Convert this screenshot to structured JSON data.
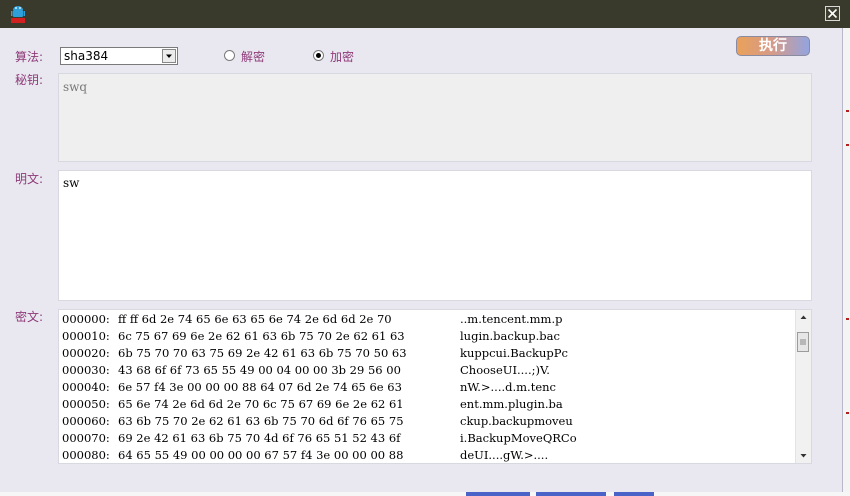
{
  "window": {
    "icon": "android-robot-icon",
    "close": "close-icon"
  },
  "form": {
    "algorithm_label": "算法:",
    "algorithm_value": "sha384",
    "radio_decrypt": "解密",
    "radio_encrypt": "加密",
    "selected_mode": "encrypt",
    "execute_label": "执行",
    "key_label": "秘钥:",
    "key_value": "swq",
    "plaintext_label": "明文:",
    "plaintext_value": "sw",
    "ciphertext_label": "密文:"
  },
  "hexdump": [
    {
      "addr": "000000:",
      "bytes": "ff ff 6d 2e 74 65 6e 63 65 6e 74 2e 6d 6d 2e 70",
      "ascii": "..m.tencent.mm.p"
    },
    {
      "addr": "000010:",
      "bytes": "6c 75 67 69 6e 2e 62 61 63 6b 75 70 2e 62 61 63",
      "ascii": "lugin.backup.bac"
    },
    {
      "addr": "000020:",
      "bytes": "6b 75 70 70 63 75 69 2e 42 61 63 6b 75 70 50 63",
      "ascii": "kuppcui.BackupPc"
    },
    {
      "addr": "000030:",
      "bytes": "43 68 6f 6f 73 65 55 49 00 04 00 00 3b 29 56 00",
      "ascii": "ChooseUI....;)V."
    },
    {
      "addr": "000040:",
      "bytes": "6e 57 f4 3e 00 00 00 88 64 07 6d 2e 74 65 6e 63",
      "ascii": "nW.>....d.m.tenc"
    },
    {
      "addr": "000050:",
      "bytes": "65 6e 74 2e 6d 6d 2e 70 6c 75 67 69 6e 2e 62 61",
      "ascii": "ent.mm.plugin.ba"
    },
    {
      "addr": "000060:",
      "bytes": "63 6b 75 70 2e 62 61 63 6b 75 70 6d 6f 76 65 75",
      "ascii": "ckup.backupmoveu"
    },
    {
      "addr": "000070:",
      "bytes": "69 2e 42 61 63 6b 75 70 4d 6f 76 65 51 52 43 6f",
      "ascii": "i.BackupMoveQRCo"
    },
    {
      "addr": "000080:",
      "bytes": "64 65 55 49 00 00 00 00 67 57 f4 3e 00 00 00 88",
      "ascii": "deUI....gW.>...."
    }
  ],
  "colors": {
    "titlebar": "#393a2c",
    "label": "#8e3a78",
    "window_bg": "#e9e8f1"
  }
}
